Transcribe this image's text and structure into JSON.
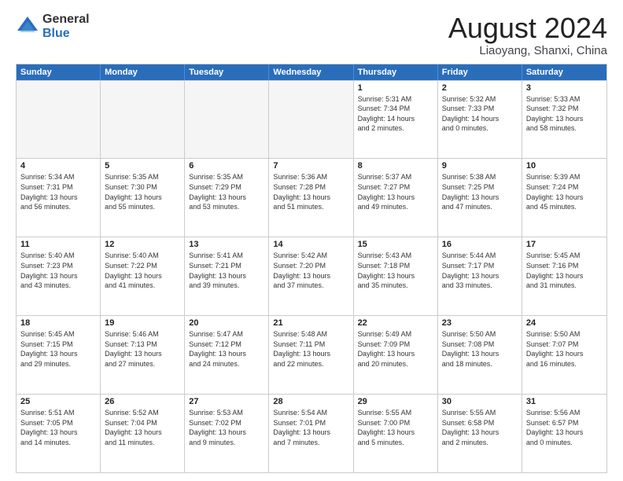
{
  "logo": {
    "general": "General",
    "blue": "Blue"
  },
  "header": {
    "month": "August 2024",
    "location": "Liaoyang, Shanxi, China"
  },
  "weekdays": [
    "Sunday",
    "Monday",
    "Tuesday",
    "Wednesday",
    "Thursday",
    "Friday",
    "Saturday"
  ],
  "rows": [
    [
      {
        "day": "",
        "info": "",
        "empty": true
      },
      {
        "day": "",
        "info": "",
        "empty": true
      },
      {
        "day": "",
        "info": "",
        "empty": true
      },
      {
        "day": "",
        "info": "",
        "empty": true
      },
      {
        "day": "1",
        "info": "Sunrise: 5:31 AM\nSunset: 7:34 PM\nDaylight: 14 hours\nand 2 minutes."
      },
      {
        "day": "2",
        "info": "Sunrise: 5:32 AM\nSunset: 7:33 PM\nDaylight: 14 hours\nand 0 minutes."
      },
      {
        "day": "3",
        "info": "Sunrise: 5:33 AM\nSunset: 7:32 PM\nDaylight: 13 hours\nand 58 minutes."
      }
    ],
    [
      {
        "day": "4",
        "info": "Sunrise: 5:34 AM\nSunset: 7:31 PM\nDaylight: 13 hours\nand 56 minutes."
      },
      {
        "day": "5",
        "info": "Sunrise: 5:35 AM\nSunset: 7:30 PM\nDaylight: 13 hours\nand 55 minutes."
      },
      {
        "day": "6",
        "info": "Sunrise: 5:35 AM\nSunset: 7:29 PM\nDaylight: 13 hours\nand 53 minutes."
      },
      {
        "day": "7",
        "info": "Sunrise: 5:36 AM\nSunset: 7:28 PM\nDaylight: 13 hours\nand 51 minutes."
      },
      {
        "day": "8",
        "info": "Sunrise: 5:37 AM\nSunset: 7:27 PM\nDaylight: 13 hours\nand 49 minutes."
      },
      {
        "day": "9",
        "info": "Sunrise: 5:38 AM\nSunset: 7:25 PM\nDaylight: 13 hours\nand 47 minutes."
      },
      {
        "day": "10",
        "info": "Sunrise: 5:39 AM\nSunset: 7:24 PM\nDaylight: 13 hours\nand 45 minutes."
      }
    ],
    [
      {
        "day": "11",
        "info": "Sunrise: 5:40 AM\nSunset: 7:23 PM\nDaylight: 13 hours\nand 43 minutes."
      },
      {
        "day": "12",
        "info": "Sunrise: 5:40 AM\nSunset: 7:22 PM\nDaylight: 13 hours\nand 41 minutes."
      },
      {
        "day": "13",
        "info": "Sunrise: 5:41 AM\nSunset: 7:21 PM\nDaylight: 13 hours\nand 39 minutes."
      },
      {
        "day": "14",
        "info": "Sunrise: 5:42 AM\nSunset: 7:20 PM\nDaylight: 13 hours\nand 37 minutes."
      },
      {
        "day": "15",
        "info": "Sunrise: 5:43 AM\nSunset: 7:18 PM\nDaylight: 13 hours\nand 35 minutes."
      },
      {
        "day": "16",
        "info": "Sunrise: 5:44 AM\nSunset: 7:17 PM\nDaylight: 13 hours\nand 33 minutes."
      },
      {
        "day": "17",
        "info": "Sunrise: 5:45 AM\nSunset: 7:16 PM\nDaylight: 13 hours\nand 31 minutes."
      }
    ],
    [
      {
        "day": "18",
        "info": "Sunrise: 5:45 AM\nSunset: 7:15 PM\nDaylight: 13 hours\nand 29 minutes."
      },
      {
        "day": "19",
        "info": "Sunrise: 5:46 AM\nSunset: 7:13 PM\nDaylight: 13 hours\nand 27 minutes."
      },
      {
        "day": "20",
        "info": "Sunrise: 5:47 AM\nSunset: 7:12 PM\nDaylight: 13 hours\nand 24 minutes."
      },
      {
        "day": "21",
        "info": "Sunrise: 5:48 AM\nSunset: 7:11 PM\nDaylight: 13 hours\nand 22 minutes."
      },
      {
        "day": "22",
        "info": "Sunrise: 5:49 AM\nSunset: 7:09 PM\nDaylight: 13 hours\nand 20 minutes."
      },
      {
        "day": "23",
        "info": "Sunrise: 5:50 AM\nSunset: 7:08 PM\nDaylight: 13 hours\nand 18 minutes."
      },
      {
        "day": "24",
        "info": "Sunrise: 5:50 AM\nSunset: 7:07 PM\nDaylight: 13 hours\nand 16 minutes."
      }
    ],
    [
      {
        "day": "25",
        "info": "Sunrise: 5:51 AM\nSunset: 7:05 PM\nDaylight: 13 hours\nand 14 minutes."
      },
      {
        "day": "26",
        "info": "Sunrise: 5:52 AM\nSunset: 7:04 PM\nDaylight: 13 hours\nand 11 minutes."
      },
      {
        "day": "27",
        "info": "Sunrise: 5:53 AM\nSunset: 7:02 PM\nDaylight: 13 hours\nand 9 minutes."
      },
      {
        "day": "28",
        "info": "Sunrise: 5:54 AM\nSunset: 7:01 PM\nDaylight: 13 hours\nand 7 minutes."
      },
      {
        "day": "29",
        "info": "Sunrise: 5:55 AM\nSunset: 7:00 PM\nDaylight: 13 hours\nand 5 minutes."
      },
      {
        "day": "30",
        "info": "Sunrise: 5:55 AM\nSunset: 6:58 PM\nDaylight: 13 hours\nand 2 minutes."
      },
      {
        "day": "31",
        "info": "Sunrise: 5:56 AM\nSunset: 6:57 PM\nDaylight: 13 hours\nand 0 minutes."
      }
    ]
  ]
}
